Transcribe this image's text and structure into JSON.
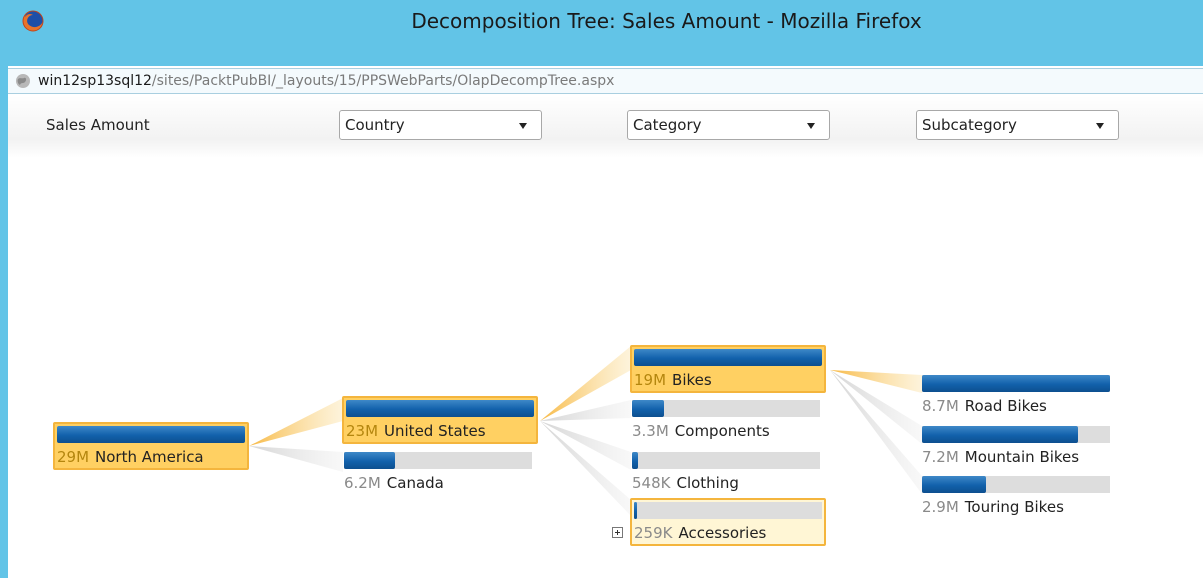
{
  "window": {
    "title": "Decomposition Tree: Sales Amount - Mozilla Firefox",
    "url_host": "win12sp13sql12",
    "url_path": "/sites/PacktPubBI/_layouts/15/PPSWebParts/OlapDecompTree.aspx"
  },
  "header": {
    "measure": "Sales Amount",
    "levels": [
      {
        "selected": "Country"
      },
      {
        "selected": "Category"
      },
      {
        "selected": "Subcategory"
      }
    ]
  },
  "tree": {
    "root": {
      "value": "29M",
      "name": "North America",
      "fill": 1.0,
      "state": "selected"
    },
    "country": [
      {
        "value": "23M",
        "name": "United States",
        "fill": 1.0,
        "state": "selected"
      },
      {
        "value": "6.2M",
        "name": "Canada",
        "fill": 0.27,
        "state": "normal"
      }
    ],
    "category": [
      {
        "value": "19M",
        "name": "Bikes",
        "fill": 1.0,
        "state": "selected"
      },
      {
        "value": "3.3M",
        "name": "Components",
        "fill": 0.17,
        "state": "normal"
      },
      {
        "value": "548K",
        "name": "Clothing",
        "fill": 0.03,
        "state": "normal"
      },
      {
        "value": "259K",
        "name": "Accessories",
        "fill": 0.015,
        "state": "highlight"
      }
    ],
    "subcategory": [
      {
        "value": "8.7M",
        "name": "Road Bikes",
        "fill": 1.0,
        "state": "normal"
      },
      {
        "value": "7.2M",
        "name": "Mountain Bikes",
        "fill": 0.83,
        "state": "normal"
      },
      {
        "value": "2.9M",
        "name": "Touring Bikes",
        "fill": 0.34,
        "state": "normal"
      }
    ]
  },
  "colors": {
    "titlebar": "#62c4e7",
    "bar": "#1261ab",
    "selected_node": "#ffd062",
    "connector": "#f7c25a"
  }
}
